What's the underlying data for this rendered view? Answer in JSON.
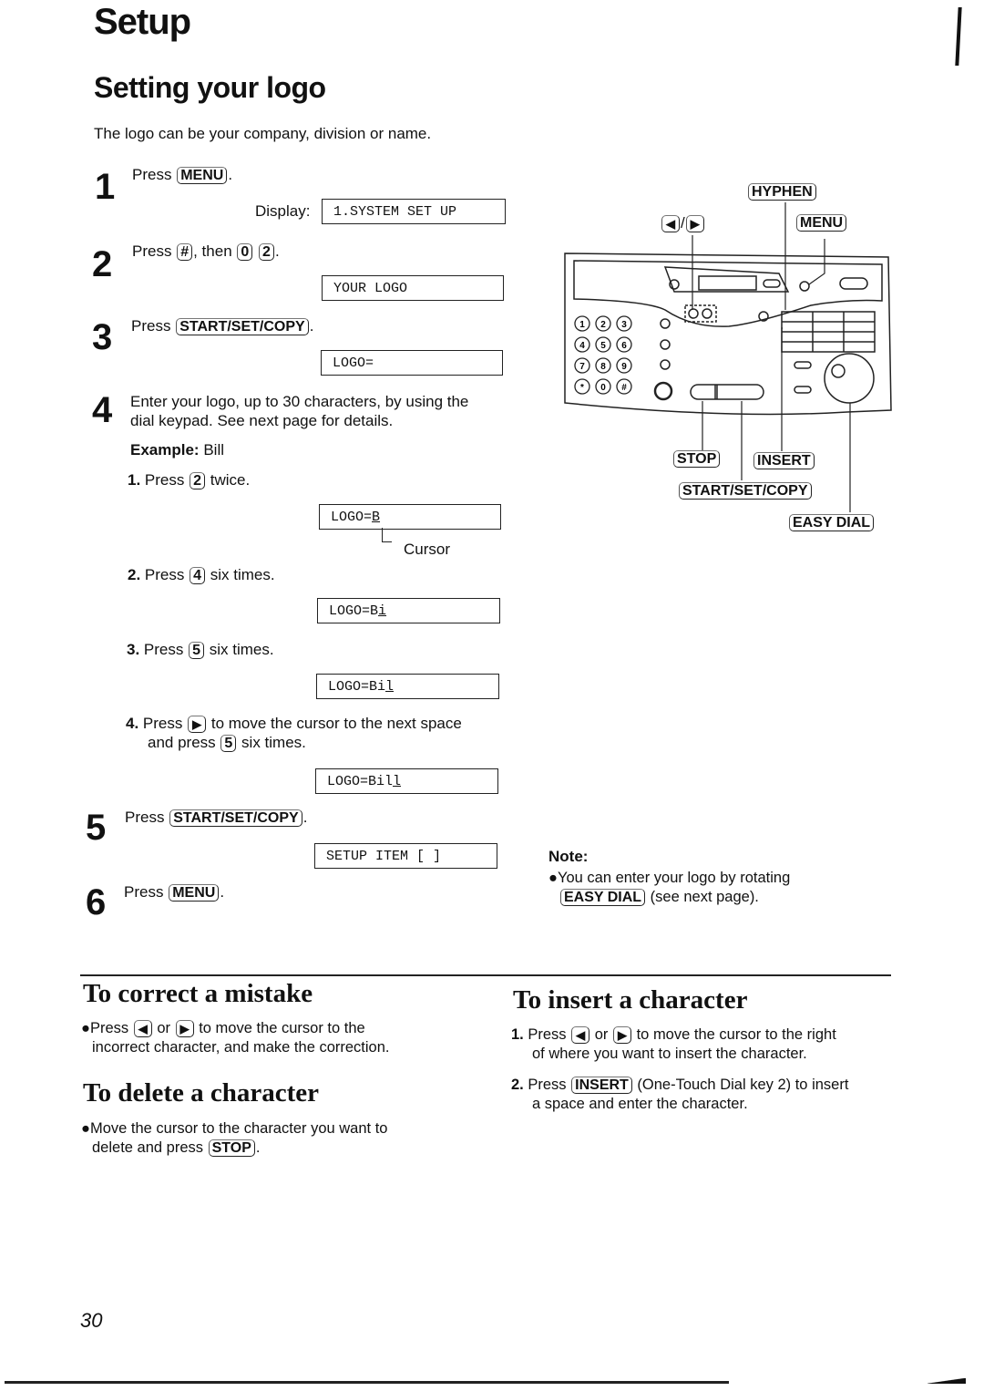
{
  "header": {
    "section": "Setup",
    "title": "Setting your logo",
    "intro": "The logo can be your company, division or name."
  },
  "steps": [
    {
      "num": "1",
      "pre": "Press",
      "key": "MENU",
      "post": ".",
      "display_label": "Display:",
      "display": "1.SYSTEM SET UP"
    },
    {
      "num": "2",
      "pre": "Press",
      "key": "#",
      "mid": ", then",
      "key2": "0",
      "key3": "2",
      "post": ".",
      "display": "YOUR LOGO"
    },
    {
      "num": "3",
      "pre": "Press",
      "key": "START/SET/COPY",
      "post": ".",
      "display": "LOGO="
    },
    {
      "num": "4",
      "text_line1": "Enter your logo, up to 30 characters, by using the",
      "text_line2": "dial keypad. See next page for details.",
      "example_label": "Example:",
      "example_value": "Bill",
      "substeps": [
        {
          "num": "1.",
          "pre": "Press",
          "key": "2",
          "post": "twice.",
          "display_prefix": "LOGO=",
          "display_cursor": "B",
          "display_suffix": "",
          "annotation": "Cursor"
        },
        {
          "num": "2.",
          "pre": "Press",
          "key": "4",
          "post": "six times.",
          "display_prefix": "LOGO=B",
          "display_cursor": "i",
          "display_suffix": ""
        },
        {
          "num": "3.",
          "pre": "Press",
          "key": "5",
          "post": "six times.",
          "display_prefix": "LOGO=Bi",
          "display_cursor": "l",
          "display_suffix": ""
        },
        {
          "num": "4.",
          "pre": "Press",
          "key": "▶",
          "post": "to move the cursor to the next space",
          "line2_pre": "and press",
          "key2": "5",
          "line2_post": "six times.",
          "display_prefix": "LOGO=Bil",
          "display_cursor": "l",
          "display_suffix": ""
        }
      ]
    },
    {
      "num": "5",
      "pre": "Press",
      "key": "START/SET/COPY",
      "post": ".",
      "display": "SETUP ITEM [   ]"
    },
    {
      "num": "6",
      "pre": "Press",
      "key": "MENU",
      "post": "."
    }
  ],
  "diagram": {
    "callouts": {
      "hyphen": "HYPHEN",
      "arrows_left": "◀",
      "arrows_sep": "/",
      "arrows_right": "▶",
      "menu": "MENU",
      "stop": "STOP",
      "insert": "INSERT",
      "start": "START/SET/COPY",
      "easy_dial": "EASY DIAL"
    },
    "keypad": [
      "1",
      "2",
      "3",
      "4",
      "5",
      "6",
      "7",
      "8",
      "9",
      "*",
      "0",
      "#"
    ]
  },
  "note": {
    "title": "Note:",
    "line1": "●You can enter your logo by rotating",
    "key": "EASY DIAL",
    "line2_post": "(see next page)."
  },
  "correct": {
    "title": "To correct a mistake",
    "pre": "●Press",
    "key1": "◀",
    "or": "or",
    "key2": "▶",
    "post": "to move the cursor to the",
    "line2": "incorrect character, and make the correction."
  },
  "delete": {
    "title": "To delete a character",
    "line1": "●Move the cursor to the character you want to",
    "line2_pre": "delete and press",
    "key": "STOP",
    "line2_post": "."
  },
  "insert": {
    "title": "To insert a character",
    "items": [
      {
        "num": "1.",
        "pre": "Press",
        "key1": "◀",
        "or": "or",
        "key2": "▶",
        "post": "to move the cursor to the right",
        "line2": "of where you want to insert the character."
      },
      {
        "num": "2.",
        "pre": "Press",
        "key": "INSERT",
        "post": "(One-Touch Dial key 2) to insert",
        "line2": "a space and enter the character."
      }
    ]
  },
  "footer": {
    "page_number": "30"
  }
}
